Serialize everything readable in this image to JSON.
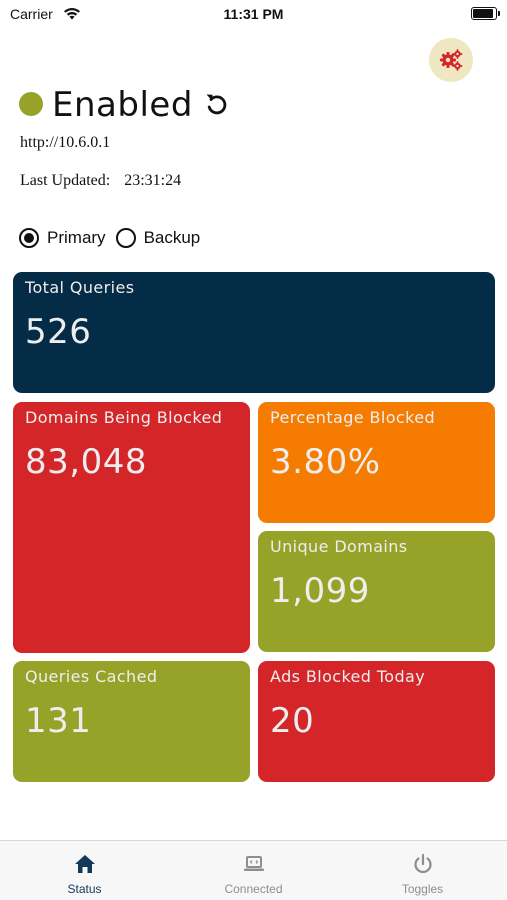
{
  "status_bar": {
    "carrier": "Carrier",
    "time": "11:31 PM"
  },
  "header": {
    "status": "Enabled",
    "status_color": "#97a229",
    "host_url": "http://10.6.0.1",
    "last_updated_label": "Last Updated:",
    "last_updated_time": "23:31:24"
  },
  "server_select": {
    "options": [
      {
        "label": "Primary",
        "selected": true
      },
      {
        "label": "Backup",
        "selected": false
      }
    ]
  },
  "stats": {
    "total_queries": {
      "label": "Total Queries",
      "value": "526",
      "color": "#042c47"
    },
    "domains_blocked": {
      "label": "Domains Being Blocked",
      "value": "83,048",
      "color": "#d42629"
    },
    "percentage_blocked": {
      "label": "Percentage Blocked",
      "value": "3.80%",
      "color": "#f57c00"
    },
    "unique_domains": {
      "label": "Unique Domains",
      "value": "1,099",
      "color": "#97a229"
    },
    "queries_cached": {
      "label": "Queries Cached",
      "value": "131",
      "color": "#97a229"
    },
    "ads_blocked_today": {
      "label": "Ads Blocked Today",
      "value": "20",
      "color": "#d42629"
    }
  },
  "tabs": [
    {
      "label": "Status",
      "icon": "home-icon",
      "active": true
    },
    {
      "label": "Connected",
      "icon": "laptop-icon",
      "active": false
    },
    {
      "label": "Toggles",
      "icon": "power-icon",
      "active": false
    }
  ],
  "icons": {
    "settings": "gears-icon",
    "refresh": "refresh-icon"
  }
}
